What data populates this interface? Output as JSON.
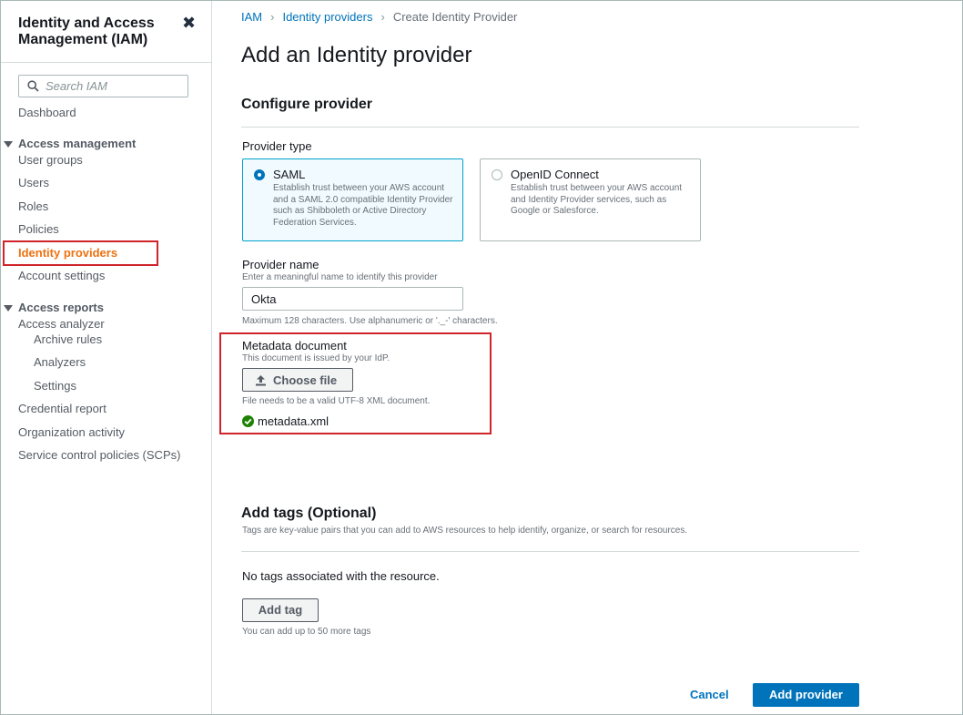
{
  "sidebar": {
    "title": "Identity and Access Management (IAM)",
    "search_placeholder": "Search IAM",
    "dashboard": "Dashboard",
    "access_management": {
      "heading": "Access management",
      "items": [
        "User groups",
        "Users",
        "Roles",
        "Policies",
        "Identity providers",
        "Account settings"
      ],
      "active": "Identity providers"
    },
    "access_reports": {
      "heading": "Access reports",
      "analyzer": "Access analyzer",
      "analyzer_items": [
        "Archive rules",
        "Analyzers",
        "Settings"
      ],
      "items": [
        "Credential report",
        "Organization activity",
        "Service control policies (SCPs)"
      ]
    }
  },
  "breadcrumb": {
    "items": [
      "IAM",
      "Identity providers",
      "Create Identity Provider"
    ]
  },
  "page_title": "Add an Identity provider",
  "configure": {
    "title": "Configure provider",
    "provider_type_label": "Provider type",
    "options": [
      {
        "title": "SAML",
        "desc": "Establish trust between your AWS account and a SAML 2.0 compatible Identity Provider such as Shibboleth or Active Directory Federation Services.",
        "selected": true
      },
      {
        "title": "OpenID Connect",
        "desc": "Establish trust between your AWS account and Identity Provider services, such as Google or Salesforce.",
        "selected": false
      }
    ],
    "provider_name": {
      "label": "Provider name",
      "desc": "Enter a meaningful name to identify this provider",
      "value": "Okta",
      "hint": "Maximum 128 characters. Use alphanumeric or '._-' characters."
    },
    "metadata": {
      "label": "Metadata document",
      "desc": "This document is issued by your IdP.",
      "button": "Choose file",
      "hint": "File needs to be a valid UTF-8 XML document.",
      "file": "metadata.xml"
    }
  },
  "tags": {
    "title": "Add tags (Optional)",
    "desc": "Tags are key-value pairs that you can add to AWS resources to help identify, organize, or search for resources.",
    "empty": "No tags associated with the resource.",
    "add_button": "Add tag",
    "hint": "You can add up to 50 more tags"
  },
  "footer": {
    "cancel": "Cancel",
    "submit": "Add provider"
  },
  "colors": {
    "link": "#0073bb",
    "active_nav": "#ec7211",
    "highlight": "#d0242b",
    "success": "#1d8102"
  },
  "icons": [
    "close-icon",
    "search-icon",
    "caret-down-icon",
    "upload-icon",
    "check-circle-icon"
  ]
}
